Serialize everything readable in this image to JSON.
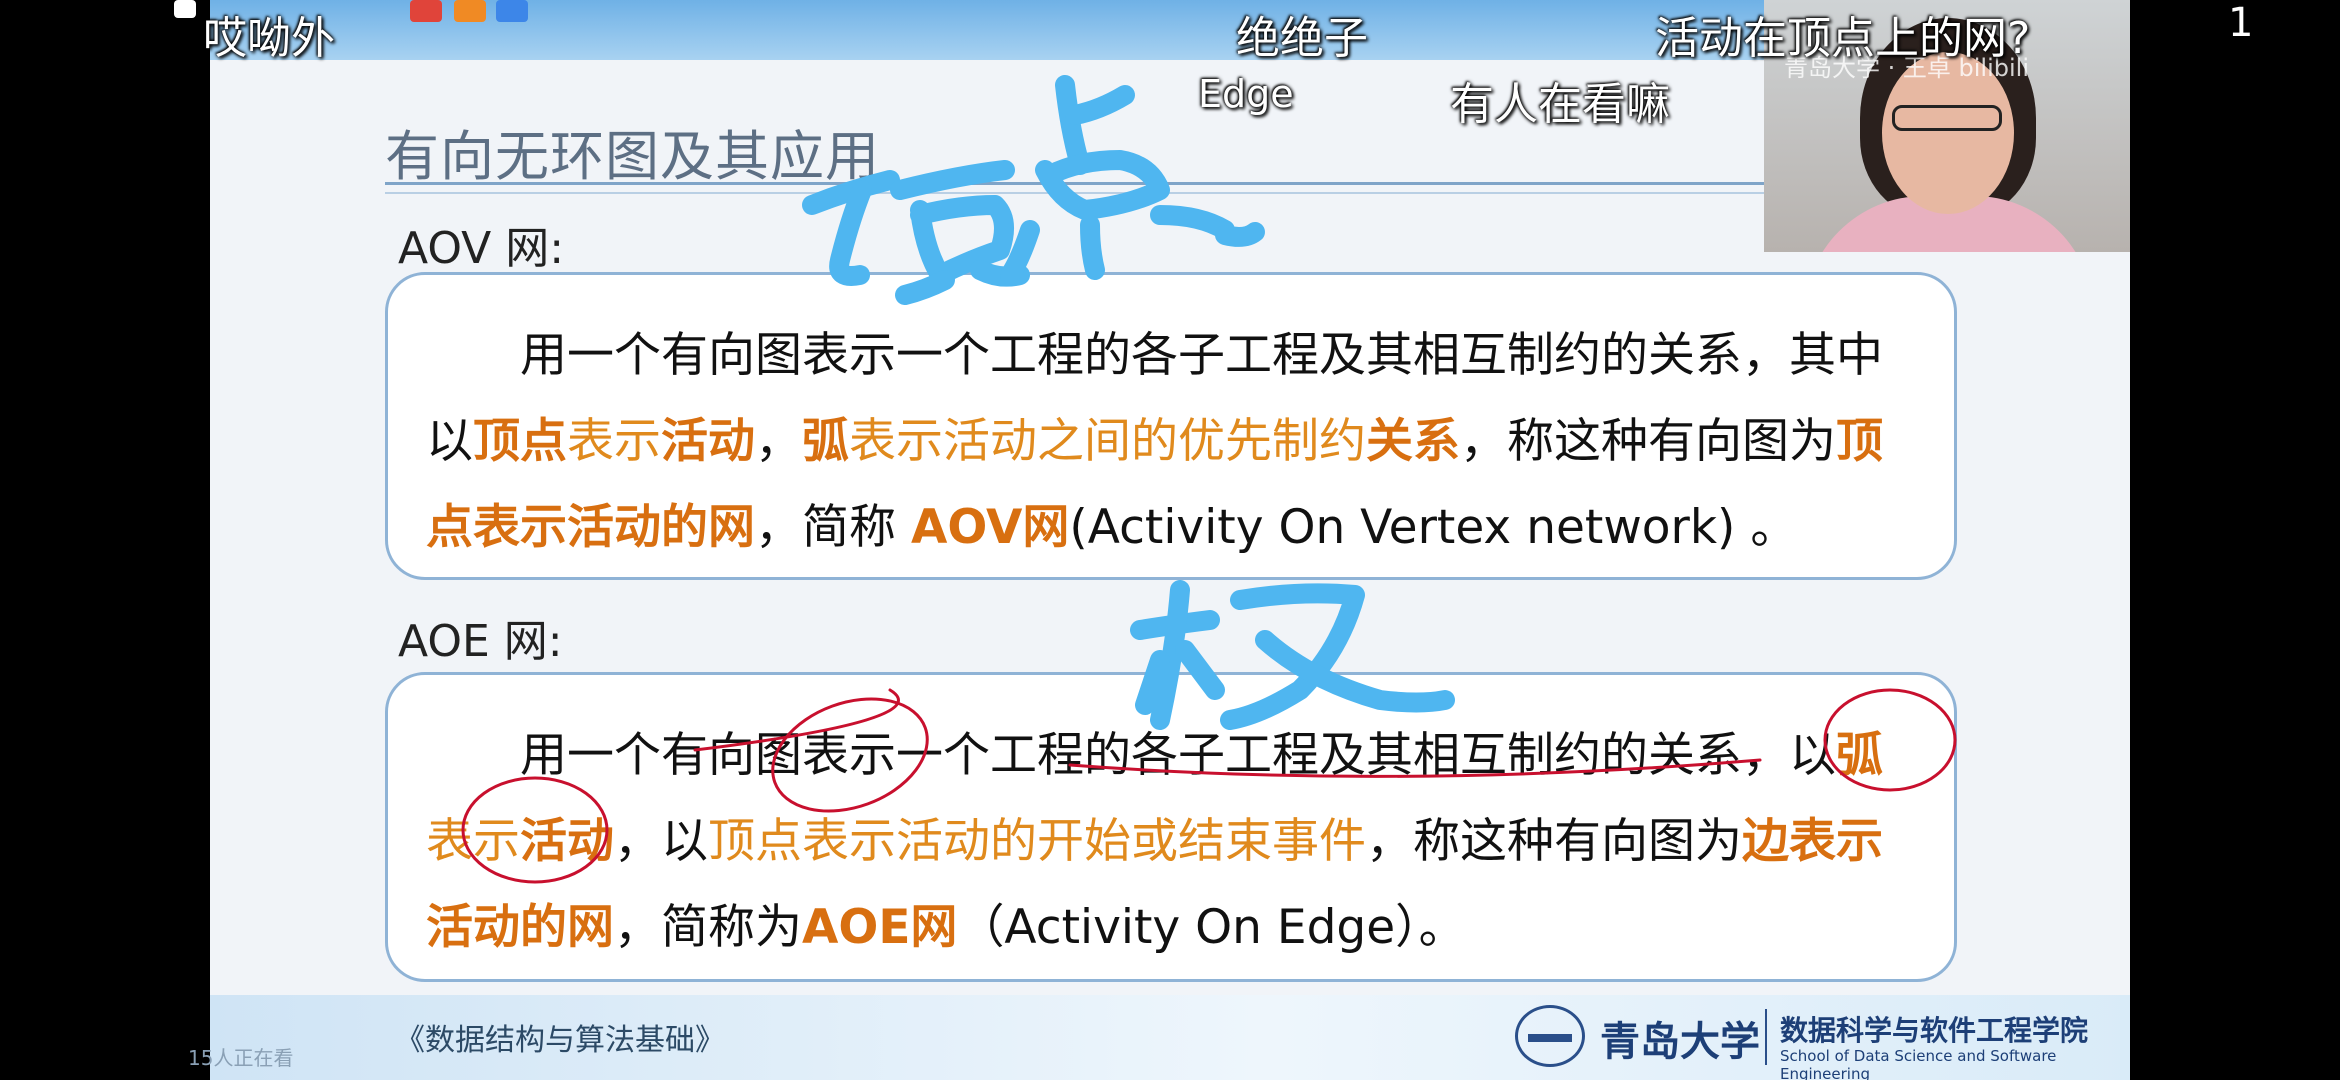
{
  "slide": {
    "title": "有向无环图及其应用",
    "aov": {
      "label": "AOV 网:",
      "p1": "用一个有向图表示一个工程的各子工程及其相互制约的关系，其中",
      "p2_a": "以",
      "p2_b": "顶点",
      "p2_c": "表示",
      "p2_d": "活动",
      "p2_e": "，",
      "p2_f": "弧",
      "p2_g": "表示活动之间的优先制约",
      "p2_h": "关系",
      "p2_i": "，称这种有向图为",
      "p2_j": "顶",
      "p3_a": "点表示活动的网",
      "p3_b": "，简称 ",
      "p3_c": "AOV网",
      "p3_d": "(Activity On Vertex network) 。"
    },
    "aoe": {
      "label": "AOE 网:",
      "p1_a": "用一个有向图表示一个工程的各子工程及其相互制约的关系，",
      "p1_b": "以",
      "p1_c": "弧",
      "p2_a": "表示",
      "p2_b": "活动",
      "p2_c": "，以",
      "p2_d": "顶点表示活动的开始或结束事件",
      "p2_e": "，称这种有向图为",
      "p2_f": "边表示",
      "p3_a": "活动的网",
      "p3_b": "，简称为",
      "p3_c": "AOE网",
      "p3_d": "（Activity  On  Edge）。"
    },
    "footer": {
      "course": "《数据结构与算法基础》",
      "university": "青岛大学",
      "school": "数据科学与软件工程学院",
      "school_en": "School of Data Science and Software Engineering"
    }
  },
  "overlay": {
    "top_left": "哎呦外",
    "top_center": "绝绝子",
    "top_right": "活动在顶点上的网?",
    "page_num": "1",
    "comment_edge": "Edge",
    "comment_watch": "有人在看嘛",
    "viewers": "15人正在看",
    "ink_top": "顶点",
    "ink_mid": "权"
  },
  "viewer_cam": {
    "watermark": "青岛大学 · 王卓 bilibili"
  },
  "colors": {
    "accent_orange": "#e08a1d",
    "ink_blue": "#4fb6f0",
    "ink_red": "#c8102e",
    "box_border": "#8fb3d6"
  }
}
